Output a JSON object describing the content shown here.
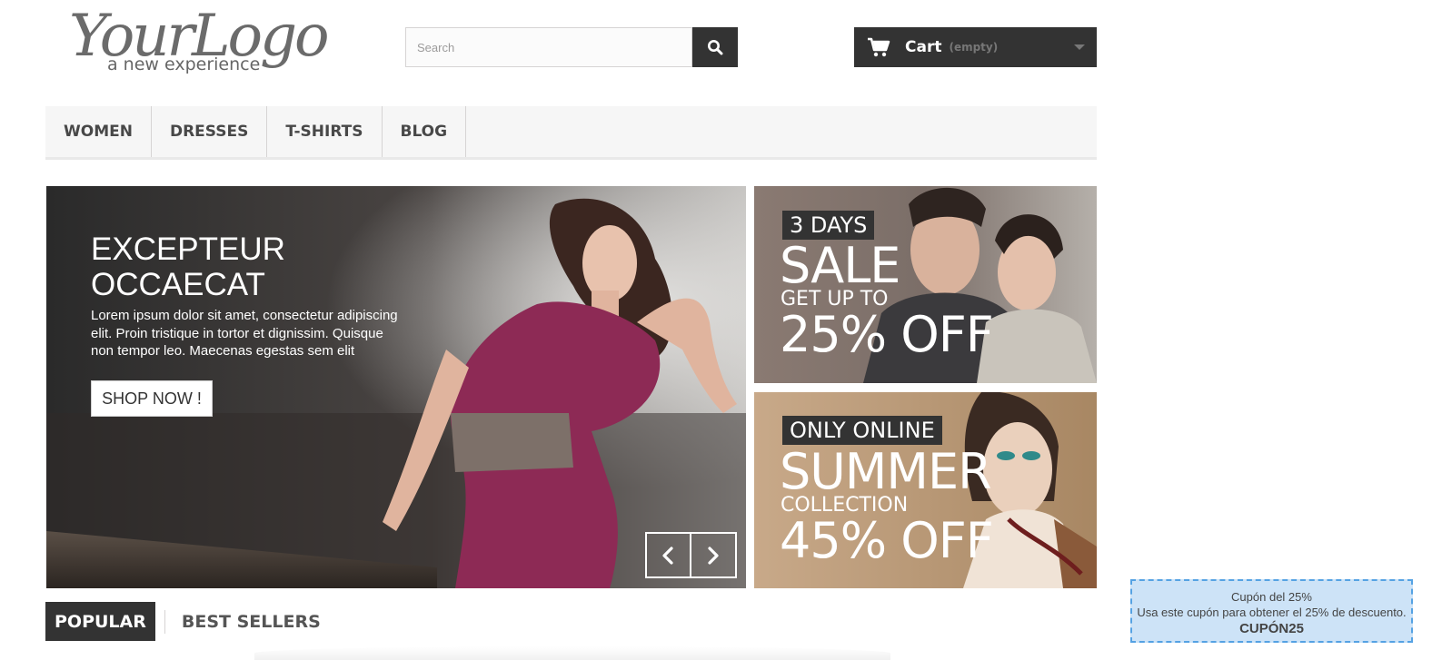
{
  "header": {
    "logo_main": "YourLogo",
    "logo_tagline": "a new experience",
    "search_placeholder": "Search",
    "search_icon": "search-icon",
    "cart_label": "Cart",
    "cart_status": "(empty)",
    "cart_icon": "shopping-cart-icon"
  },
  "nav": {
    "items": [
      {
        "label": "WOMEN"
      },
      {
        "label": "DRESSES"
      },
      {
        "label": "T-SHIRTS"
      },
      {
        "label": "BLOG"
      }
    ]
  },
  "slider": {
    "title_line1": "EXCEPTEUR",
    "title_line2": "OCCAECAT",
    "text": "Lorem ipsum dolor sit amet, consectetur adipiscing elit. Proin tristique in tortor et dignissim. Quisque non tempor leo. Maecenas egestas sem elit",
    "button_label": "SHOP NOW !",
    "prev_icon": "chevron-left-icon",
    "next_icon": "chevron-right-icon"
  },
  "banners": [
    {
      "tag": "3 DAYS",
      "headline": "SALE",
      "subline": "GET UP TO",
      "offer": "25% OFF"
    },
    {
      "tag": "ONLY ONLINE",
      "headline": "SUMMER",
      "subline": "COLLECTION",
      "offer": "45% OFF"
    }
  ],
  "tabs": [
    {
      "label": "POPULAR",
      "active": true
    },
    {
      "label": "BEST SELLERS",
      "active": false
    }
  ],
  "coupon": {
    "title": "Cupón del 25%",
    "text": "Usa este cupón para obtener el 25% de descuento.",
    "code": "CUPÓN25"
  },
  "colors": {
    "dark": "#333333",
    "nav_bg": "#f6f6f6",
    "coupon_bg": "#cde3f7",
    "coupon_border": "#55a2e3"
  }
}
